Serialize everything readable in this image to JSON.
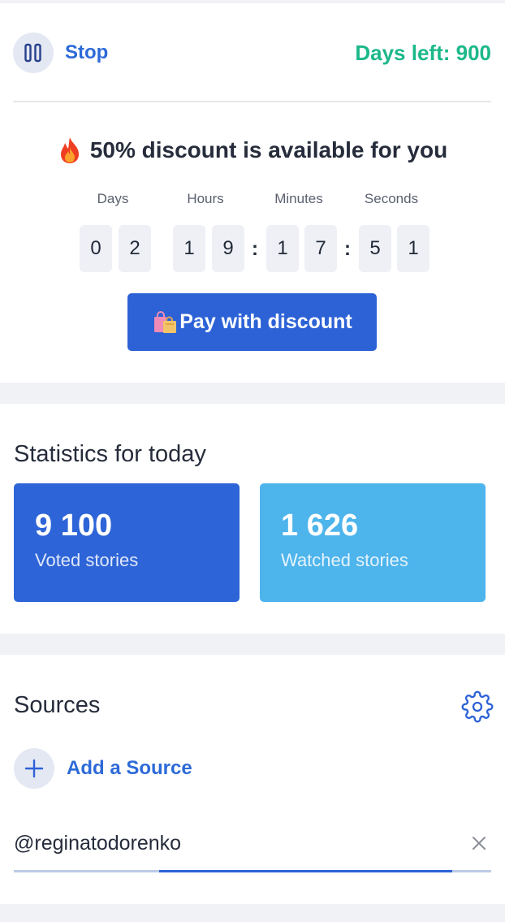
{
  "header": {
    "stop_label": "Stop",
    "days_left": "Days left: 900"
  },
  "discount": {
    "title": "50% discount is available for you",
    "units": [
      "Days",
      "Hours",
      "Minutes",
      "Seconds"
    ],
    "digits": [
      "0",
      "2",
      "1",
      "9",
      "1",
      "7",
      "5",
      "1"
    ],
    "separator": ":",
    "pay_button": "Pay with discount"
  },
  "stats": {
    "title": "Statistics for today",
    "cards": [
      {
        "value": "9 100",
        "label": "Voted stories",
        "color": "#2d64d7"
      },
      {
        "value": "1 626",
        "label": "Watched stories",
        "color": "#4db4ec"
      }
    ]
  },
  "sources": {
    "title": "Sources",
    "add_label": "Add a Source",
    "items": [
      {
        "name": "@reginatodorenko",
        "progress_from": 0.305,
        "progress_to": 0.919
      }
    ]
  },
  "colors": {
    "accent": "#2d62d6",
    "days_left": "#1cb88a"
  },
  "icons": {
    "pause": "pause-icon",
    "fire": "fire-icon",
    "bags": "shopping-bags-icon",
    "gear": "gear-icon",
    "plus": "plus-icon",
    "close": "close-icon"
  }
}
